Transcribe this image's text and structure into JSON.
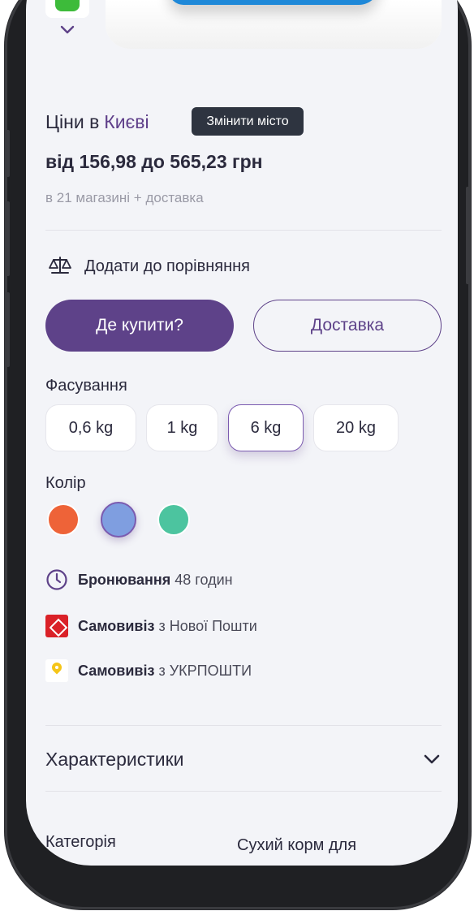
{
  "prices": {
    "city_label": "Ціни в",
    "city_name": "Києві",
    "change_city_label": "Змінити місто",
    "price_range": "від 156,98 до 565,23 грн",
    "shops_info": "в 21 магазині + доставка"
  },
  "actions": {
    "compare_label": "Додати до порівняння",
    "compare_icon": "scales-icon",
    "buy_label": "Де купити?",
    "delivery_label": "Доставка"
  },
  "packaging": {
    "title": "Фасування",
    "options": [
      "0,6 kg",
      "1 kg",
      "6 kg",
      "20 kg"
    ],
    "selected": "6 kg"
  },
  "color": {
    "title": "Колір",
    "swatches": [
      "#ee6338",
      "#7f9ee0",
      "#4cc49f"
    ],
    "selected_index": 1
  },
  "services": {
    "reservation_bold": "Бронювання",
    "reservation_rest": "48 годин",
    "np_bold": "Самовивіз",
    "np_rest": "з Нової Пошти",
    "up_bold": "Самовивіз",
    "up_rest": "з УКРПОШТИ"
  },
  "characteristics": {
    "title": "Характеристики",
    "category_label": "Категорія",
    "category_value": "Сухий корм для"
  },
  "colors": {
    "accent": "#5e4289",
    "tooltip_bg": "#2e3440",
    "background": "#f3f4f8"
  }
}
